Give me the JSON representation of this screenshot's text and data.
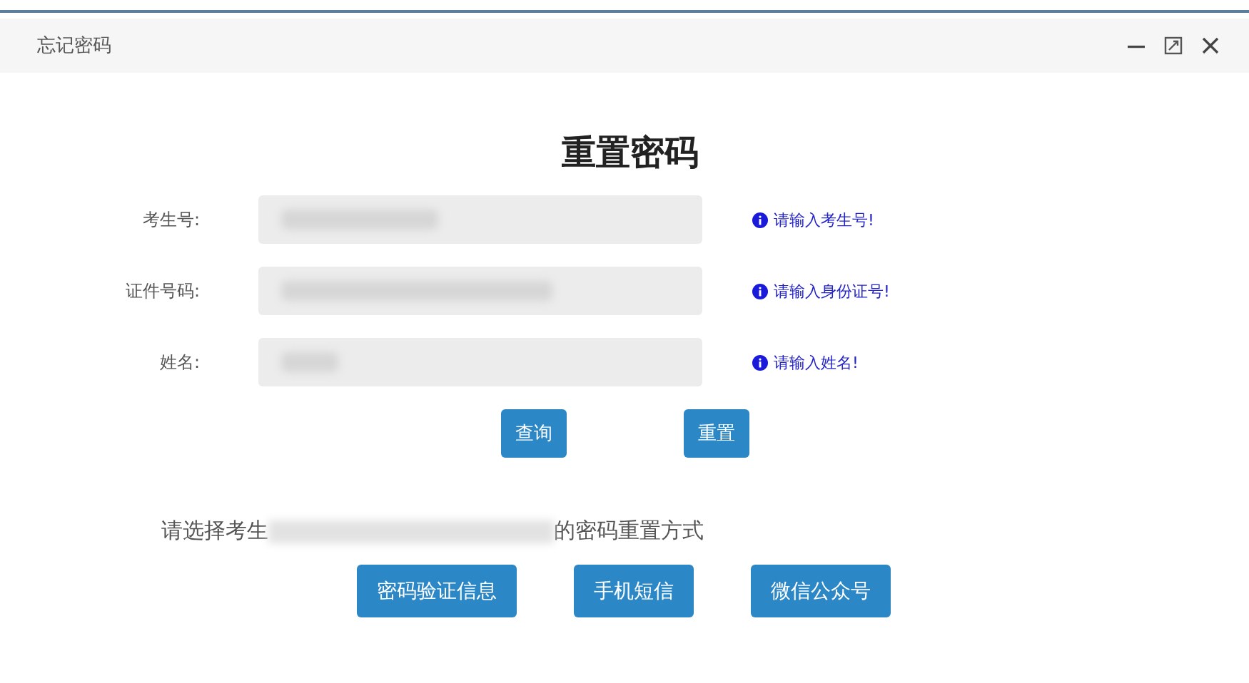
{
  "window": {
    "title": "忘记密码"
  },
  "heading": "重置密码",
  "fields": [
    {
      "label": "考生号:",
      "hint": "请输入考生号!"
    },
    {
      "label": "证件号码:",
      "hint": "请输入身份证号!"
    },
    {
      "label": "姓名:",
      "hint": "请输入姓名!"
    }
  ],
  "form_buttons": [
    "查询",
    "重置"
  ],
  "prompt": {
    "before": "请选择考生",
    "after": "的密码重置方式"
  },
  "method_buttons": [
    "密码验证信息",
    "手机短信",
    "微信公众号"
  ]
}
